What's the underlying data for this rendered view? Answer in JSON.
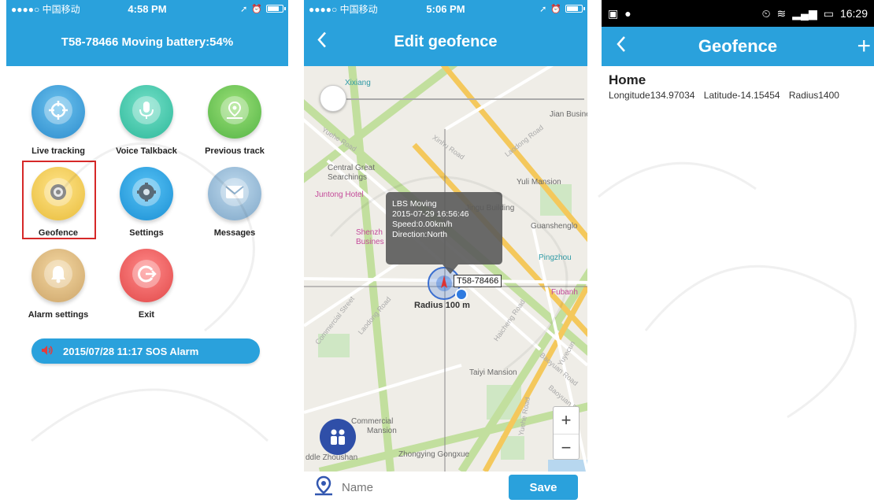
{
  "phone1": {
    "status": {
      "carrier": "●●●●○ 中国移动",
      "time": "4:58 PM"
    },
    "title": "T58-78466 Moving battery:54%",
    "apps": [
      {
        "label": "Live tracking",
        "icon": "crosshair-icon"
      },
      {
        "label": "Voice Talkback",
        "icon": "microphone-icon"
      },
      {
        "label": "Previous track",
        "icon": "map-pin-icon"
      },
      {
        "label": "Geofence",
        "icon": "geofence-icon",
        "selected": true
      },
      {
        "label": "Settings",
        "icon": "gear-icon"
      },
      {
        "label": "Messages",
        "icon": "envelope-icon"
      },
      {
        "label": "Alarm settings",
        "icon": "bell-icon"
      },
      {
        "label": "Exit",
        "icon": "exit-icon"
      }
    ],
    "sos_text": "2015/07/28 11:17 SOS Alarm"
  },
  "phone2": {
    "status": {
      "carrier": "●●●●○ 中国移动",
      "time": "5:06 PM"
    },
    "title": "Edit geofence",
    "map_labels": {
      "xixiang": "Xixiang",
      "central_great": "Central Great",
      "searchings": "Searchings",
      "juntong_hotel": "Juntong Hotel",
      "yuli_mansion": "Yuli Mansion",
      "jingu_building": "Jingu Building",
      "shenzh": "Shenzh",
      "busines": "Busines",
      "guanshenglo": "Guanshenglo",
      "pingzhou": "Pingzhou",
      "fubanh": "Fubanh",
      "taiyi_mansion": "Taiyi Mansion",
      "commercial": "Commercial",
      "mansion": "Mansion",
      "zhouhan": "ddle Zhoushan",
      "zhongying": "Zhongying Gongxue",
      "jian_business": "Jian Business",
      "yuehe_road": "Yuehe Road",
      "xinhu_road": "Xinhu Road",
      "laodong_road": "Laodong Road",
      "commercial_street": "Commercial Street",
      "laodong_road2": "Laodong Road",
      "haicheng_road": "Haicheng Road",
      "baoyuan_road": "Baoyuan Road",
      "yuyecun": "Yuyecun",
      "yuehe_road2": "Yuehe Road",
      "baoyuan_ro": "Baoyuan Ro"
    },
    "popup": {
      "line1": "LBS Moving",
      "line2": "2015-07-29 16:56:46",
      "line3": "Speed:0.00km/h",
      "line4": "Direction:North"
    },
    "device_tag": "T58-78466",
    "radius_label": "Radius 100 m",
    "zoom_in": "+",
    "zoom_out": "−",
    "name_placeholder": "Name",
    "save_label": "Save"
  },
  "phone3": {
    "status": {
      "time": "16:29"
    },
    "title": "Geofence",
    "items": [
      {
        "name": "Home",
        "longitude": "Longitude134.97034",
        "latitude": "Latitude-14.15454",
        "radius": "Radius1400"
      }
    ]
  },
  "colors": {
    "accent": "#2aa1dc",
    "highlight": "#d62828"
  }
}
